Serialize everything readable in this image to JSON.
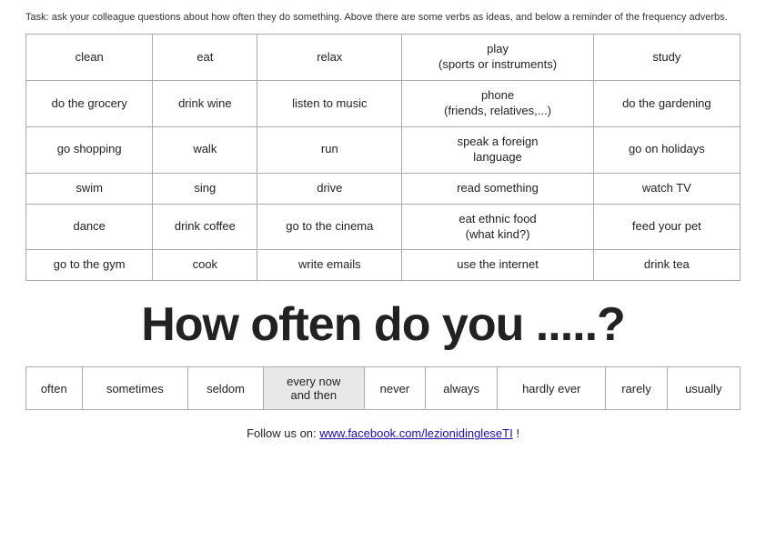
{
  "task": {
    "text": "Task: ask your colleague questions about how often they do something. Above there are some verbs as ideas, and below a reminder of the frequency adverbs."
  },
  "verbs_table": {
    "rows": [
      [
        "clean",
        "eat",
        "relax",
        "play\n(sports or instruments)",
        "study"
      ],
      [
        "do the grocery",
        "drink wine",
        "listen to music",
        "phone\n(friends, relatives,...)",
        "do the gardening"
      ],
      [
        "go shopping",
        "walk",
        "run",
        "speak a foreign\nlanguage",
        "go on holidays"
      ],
      [
        "swim",
        "sing",
        "drive",
        "read something",
        "watch TV"
      ],
      [
        "dance",
        "drink coffee",
        "go to the cinema",
        "eat ethnic food\n(what kind?)",
        "feed your pet"
      ],
      [
        "go to the gym",
        "cook",
        "write emails",
        "use the internet",
        "drink tea"
      ]
    ]
  },
  "big_question": {
    "text": "How often do you .....?"
  },
  "freq_table": {
    "cells": [
      "often",
      "sometimes",
      "seldom",
      "every now\nand then",
      "never",
      "always",
      "hardly ever",
      "rarely",
      "usually"
    ]
  },
  "footer": {
    "prefix": "Follow us on:  ",
    "link_text": "www.facebook.com/lezionidingleseTI",
    "link_href": "#",
    "suffix": "  !"
  }
}
